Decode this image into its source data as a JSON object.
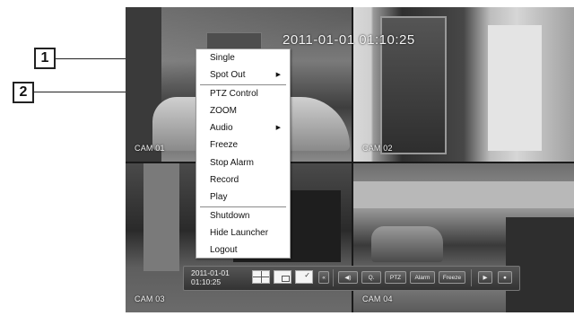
{
  "callouts": {
    "one": "1",
    "two": "2"
  },
  "timestamp": "2011-01-01 01:10:25",
  "cameras": [
    "CAM 01",
    "CAM 02",
    "CAM 03",
    "CAM 04"
  ],
  "menu": {
    "items": [
      {
        "label": "Single"
      },
      {
        "label": "Spot Out",
        "submenu": true
      },
      {
        "label": "PTZ Control"
      },
      {
        "label": "ZOOM"
      },
      {
        "label": "Audio",
        "submenu": true
      },
      {
        "label": "Freeze"
      },
      {
        "label": "Stop Alarm"
      },
      {
        "label": "Record"
      },
      {
        "label": "Play"
      },
      {
        "label": "Shutdown"
      },
      {
        "label": "Hide Launcher"
      },
      {
        "label": "Logout"
      }
    ],
    "submenu_arrow": "▶"
  },
  "launcher": {
    "date": "2011-01-01",
    "time": "01:10:25",
    "collapse": "«",
    "buttons": {
      "audio": "◀)",
      "zoom": "Q.",
      "ptz": "PTZ",
      "alarm": "Alarm",
      "freeze": "Freeze",
      "play": "▶",
      "record": "●"
    }
  }
}
